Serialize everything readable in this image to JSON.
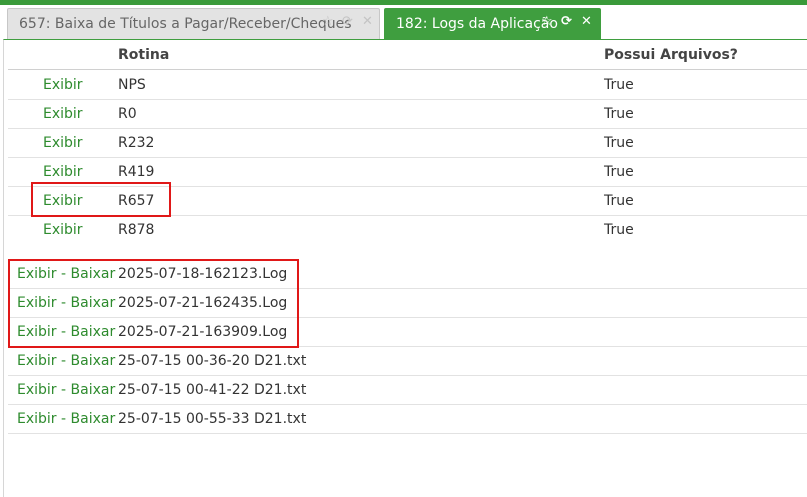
{
  "tabs": [
    {
      "label": "657: Baixa de Títulos a Pagar/Receber/Cheques",
      "active": false
    },
    {
      "label": "182: Logs da Aplicação",
      "active": true
    }
  ],
  "icons": {
    "star": "star-icon",
    "refresh": "refresh-icon",
    "close": "close-icon"
  },
  "table": {
    "columns": [
      "",
      "Rotina",
      "Possui Arquivos?"
    ],
    "rows": [
      {
        "action": "Exibir",
        "rotina": "NPS",
        "possui": "True"
      },
      {
        "action": "Exibir",
        "rotina": "R0",
        "possui": "True"
      },
      {
        "action": "Exibir",
        "rotina": "R232",
        "possui": "True"
      },
      {
        "action": "Exibir",
        "rotina": "R419",
        "possui": "True"
      },
      {
        "action": "Exibir",
        "rotina": "R657",
        "possui": "True"
      },
      {
        "action": "Exibir",
        "rotina": "R878",
        "possui": "True"
      }
    ]
  },
  "files": [
    {
      "exibir": "Exibir",
      "sep": " - ",
      "baixar": "Baixar",
      "name": "2025-07-18-162123.Log"
    },
    {
      "exibir": "Exibir",
      "sep": " - ",
      "baixar": "Baixar",
      "name": "2025-07-21-162435.Log"
    },
    {
      "exibir": "Exibir",
      "sep": " - ",
      "baixar": "Baixar",
      "name": "2025-07-21-163909.Log"
    },
    {
      "exibir": "Exibir",
      "sep": " - ",
      "baixar": "Baixar",
      "name": "25-07-15 00-36-20 D21.txt"
    },
    {
      "exibir": "Exibir",
      "sep": " - ",
      "baixar": "Baixar",
      "name": "25-07-15 00-41-22 D21.txt"
    },
    {
      "exibir": "Exibir",
      "sep": " - ",
      "baixar": "Baixar",
      "name": "25-07-15 00-55-33 D21.txt"
    }
  ],
  "colors": {
    "accent": "#3f9e3f",
    "link": "#2e8b2e",
    "highlight": "#e01818"
  }
}
